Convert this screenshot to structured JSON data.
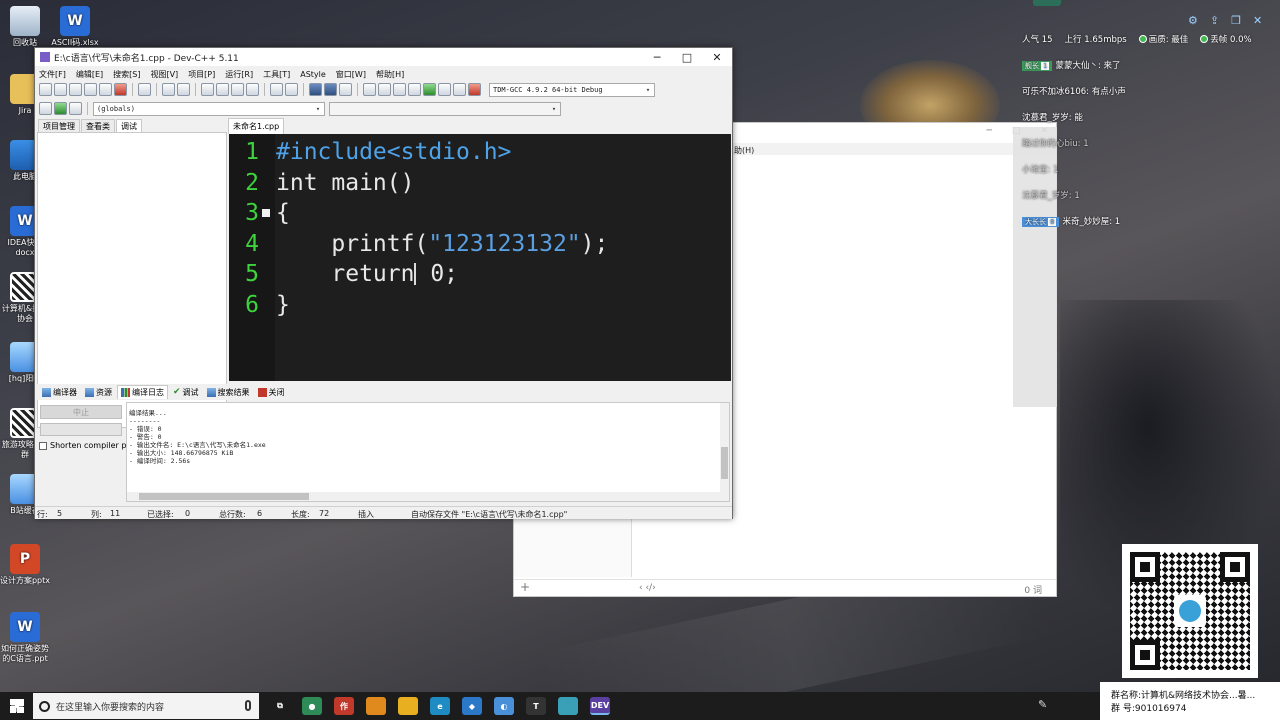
{
  "desktop": {
    "icons": [
      {
        "label": "回收站",
        "glyph": "",
        "style": "bin"
      },
      {
        "label": "ASCII码.xlsx",
        "glyph": "W",
        "style": "wps"
      },
      {
        "label": "Jira",
        "glyph": "",
        "style": "jira"
      },
      {
        "label": "此电脑",
        "glyph": "",
        "style": "pc"
      },
      {
        "label": "IDEA快捷docx",
        "glyph": "W",
        "style": "wps"
      },
      {
        "label": "计算机&技术协会",
        "glyph": "",
        "style": "qr"
      },
      {
        "label": "[hq]阳旺",
        "glyph": "",
        "style": "anime"
      },
      {
        "label": "旅游攻略[本]群",
        "glyph": "",
        "style": "qr"
      },
      {
        "label": "B站缓存",
        "glyph": "",
        "style": "anime"
      },
      {
        "label": "设计方案pptx",
        "glyph": "P",
        "style": "ppt"
      },
      {
        "label": "如何正确姿势的C语言.ppt",
        "glyph": "W",
        "style": "wps"
      }
    ]
  },
  "devcpp": {
    "title": "E:\\c语言\\代写\\未命名1.cpp - Dev-C++ 5.11",
    "window_controls": [
      "─",
      "□",
      "✕"
    ],
    "menu": [
      "文件[F]",
      "编辑[E]",
      "搜索[S]",
      "视图[V]",
      "项目[P]",
      "运行[R]",
      "工具[T]",
      "AStyle",
      "窗口[W]",
      "帮助[H]"
    ],
    "compiler_select": "TDM-GCC 4.9.2 64-bit Debug",
    "scope_select": "(globals)",
    "left_tabs": [
      "项目管理",
      "查看类",
      "调试"
    ],
    "file_tab": "未命名1.cpp",
    "code_lines": [
      {
        "num": "1",
        "parts": [
          {
            "cls": "kw-pre",
            "t": "#include<stdio.h>"
          }
        ]
      },
      {
        "num": "2",
        "parts": [
          {
            "cls": "kw",
            "t": "int main()"
          }
        ]
      },
      {
        "num": "3",
        "parts": [
          {
            "cls": "kw",
            "t": "{"
          }
        ],
        "fold": true
      },
      {
        "num": "4",
        "parts": [
          {
            "cls": "kw",
            "t": "    printf("
          },
          {
            "cls": "str",
            "t": "\"123123132\""
          },
          {
            "cls": "kw",
            "t": ");"
          }
        ]
      },
      {
        "num": "5",
        "parts": [
          {
            "cls": "kw",
            "t": "    return"
          },
          {
            "cls": "cursor",
            "t": ""
          },
          {
            "cls": "kw",
            "t": " 0;"
          }
        ]
      },
      {
        "num": "6",
        "parts": [
          {
            "cls": "kw",
            "t": "}"
          }
        ]
      }
    ],
    "bottom_tabs": [
      "编译器",
      "资源",
      "编译日志",
      "调试",
      "搜索结果",
      "关闭"
    ],
    "stop_button": "中止",
    "shorten_label": "Shorten compiler pa",
    "output_lines": [
      "编译结果...",
      "--------",
      "- 错误: 0",
      "- 警告: 0",
      "- 输出文件名: E:\\c语言\\代写\\未命名1.exe",
      "- 输出大小: 148.66796875 KiB",
      "- 编译时间: 2.56s"
    ],
    "status": {
      "row_label": "行:",
      "row": "5",
      "col_label": "列:",
      "col": "11",
      "sel_label": "已选择:",
      "sel": "0",
      "total_label": "总行数:",
      "total": "6",
      "len_label": "长度:",
      "len": "72",
      "mode": "插入",
      "autosave": "自动保存文件 \"E:\\c语言\\代写\\未命名1.cpp\""
    }
  },
  "bg_window": {
    "menu_fragment": "助(H)",
    "controls": [
      "─",
      "□",
      "✕"
    ],
    "footer_plus": "+",
    "footer_nav": "‹  ‹/›",
    "footer_count": "0 词"
  },
  "live": {
    "popularity_label": "人气",
    "popularity": "15",
    "upload_label": "上行",
    "upload": "1.65mbps",
    "quality_label": "画质: 最佳",
    "drop_label": "丢帧 0.0%",
    "chat": [
      {
        "badge": "舰长",
        "level": "1",
        "badge_color": "green",
        "text": "蒙蒙大仙丶: 来了",
        "dim": false
      },
      {
        "badge": "",
        "level": "",
        "badge_color": "",
        "text": "可乐不加冰6106: 有点小声",
        "dim": false
      },
      {
        "badge": "",
        "level": "",
        "badge_color": "",
        "text": "沈慕君_岁岁: 能",
        "dim": false
      },
      {
        "badge": "",
        "level": "",
        "badge_color": "",
        "text": "踏过你的心biu: 1",
        "dim": true
      },
      {
        "badge": "",
        "level": "",
        "badge_color": "",
        "text": "小池宝: 1",
        "dim": true
      },
      {
        "badge": "",
        "level": "",
        "badge_color": "",
        "text": "沈慕君_岁岁: 1",
        "dim": true
      },
      {
        "badge": "大长长",
        "level": "8",
        "badge_color": "blue",
        "text": "米奇_妙妙屋: 1",
        "dim": false
      }
    ],
    "group_name": "群名称:计算机&网络技术协会...暑...",
    "group_num": "群  号:901016974"
  },
  "taskbar": {
    "search_placeholder": "在这里输入你要搜索的内容",
    "apps": [
      {
        "name": "task-view",
        "glyph": "⧉",
        "color": "#1c1c1c"
      },
      {
        "name": "chrome",
        "glyph": "●",
        "color": "#2e8b57"
      },
      {
        "name": "app-red",
        "glyph": "作",
        "color": "#c0392b"
      },
      {
        "name": "app-orange",
        "glyph": "",
        "color": "#e08a1e"
      },
      {
        "name": "app-yellow",
        "glyph": "",
        "color": "#e8b020"
      },
      {
        "name": "edge",
        "glyph": "e",
        "color": "#1e8bc3"
      },
      {
        "name": "app-blue",
        "glyph": "◆",
        "color": "#2c78c8"
      },
      {
        "name": "app-circle",
        "glyph": "◐",
        "color": "#4a90d9"
      },
      {
        "name": "typora",
        "glyph": "T",
        "color": "#333"
      },
      {
        "name": "app-cyan",
        "glyph": "",
        "color": "#3aa0b8"
      },
      {
        "name": "devcpp",
        "glyph": "DEV",
        "color": "#5a3fa0"
      }
    ]
  }
}
